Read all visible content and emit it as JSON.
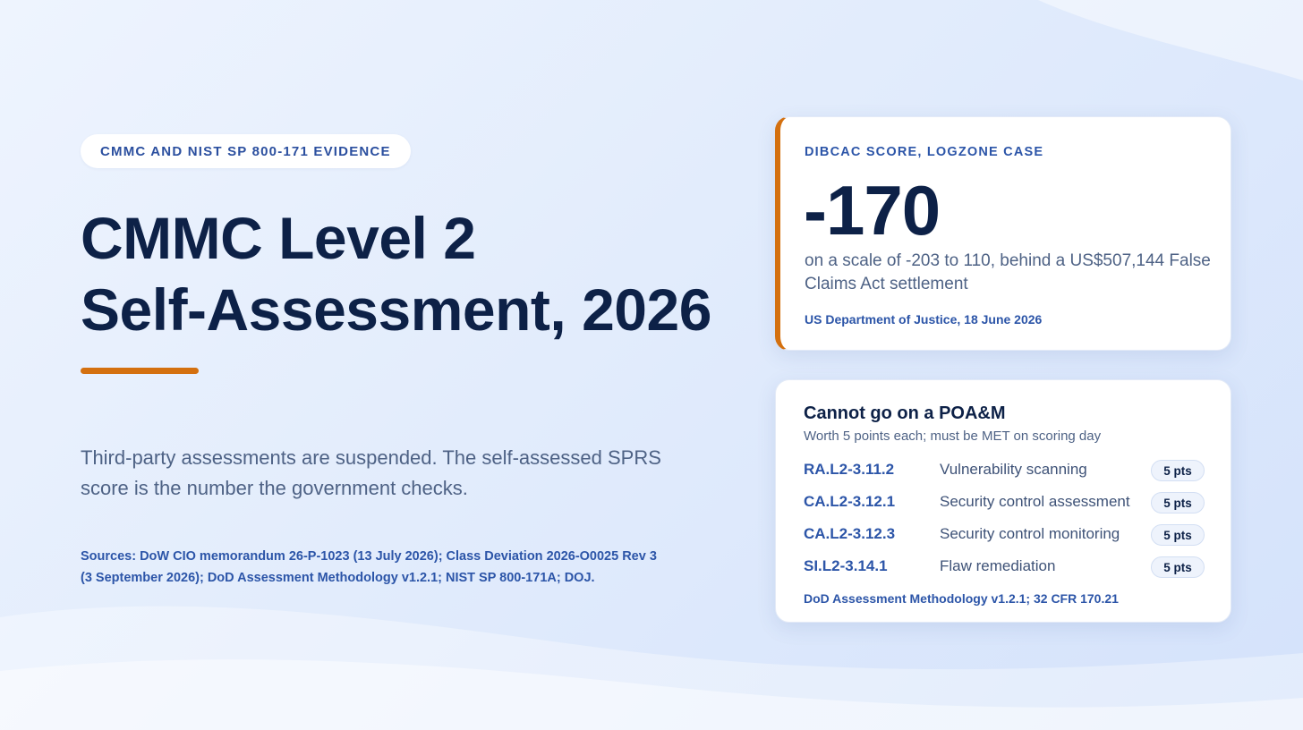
{
  "colors": {
    "accent": "#d4700f",
    "navy": "#0d2147",
    "link_blue": "#2c55a8",
    "body_text": "#4e6285"
  },
  "hero": {
    "eyebrow": "CMMC AND NIST SP 800-171 EVIDENCE",
    "title_line1": "CMMC Level 2",
    "title_line2": "Self-Assessment, 2026",
    "lede": "Third-party assessments are suspended. The self-assessed SPRS score is the number the government checks.",
    "sources": "Sources: DoW CIO memorandum 26-P-1023 (13 July 2026); Class Deviation 2026-O0025 Rev 3 (3 September 2026); DoD Assessment Methodology v1.2.1; NIST SP 800-171A; DOJ."
  },
  "score_card": {
    "label": "DIBCAC SCORE, LOGZONE CASE",
    "score": "-170",
    "description": "on a scale of -203 to 110, behind a US$507,144 False Claims Act settlement",
    "source": "US Department of Justice, 18 June 2026"
  },
  "poam_card": {
    "heading": "Cannot go on a POA&M",
    "subheading": "Worth 5 points each; must be MET on scoring day",
    "rows": [
      {
        "code": "RA.L2-3.11.2",
        "name": "Vulnerability scanning",
        "points": "5 pts"
      },
      {
        "code": "CA.L2-3.12.1",
        "name": "Security control assessment",
        "points": "5 pts"
      },
      {
        "code": "CA.L2-3.12.3",
        "name": "Security control monitoring",
        "points": "5 pts"
      },
      {
        "code": "SI.L2-3.14.1",
        "name": "Flaw remediation",
        "points": "5 pts"
      }
    ],
    "source": "DoD Assessment Methodology v1.2.1; 32 CFR 170.21"
  }
}
